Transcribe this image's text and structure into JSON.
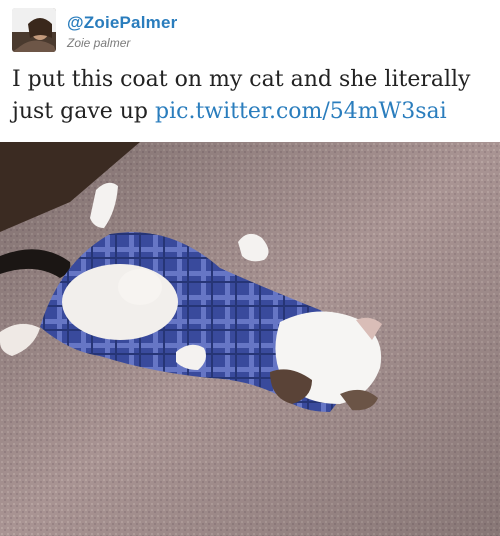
{
  "tweet": {
    "handle": "@ZoiePalmer",
    "display_name": "Zoie palmer",
    "text": "I put this coat on my cat and she literally just gave up",
    "link": "pic.twitter.com/54mW3sai"
  },
  "colors": {
    "link": "#2a7dbd",
    "name": "#7b7b7b"
  }
}
